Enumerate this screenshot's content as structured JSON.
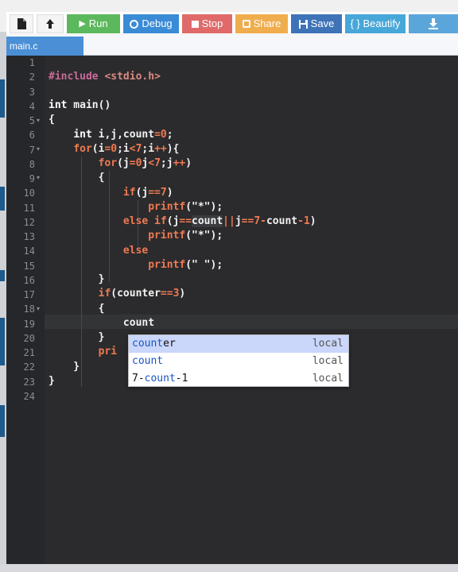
{
  "toolbar": {
    "buttons": [
      {
        "id": "new-file",
        "label": "",
        "icon": "file-icon",
        "color": "#f4f4f4"
      },
      {
        "id": "upload",
        "label": "",
        "icon": "upload-icon",
        "color": "#f4f4f4"
      },
      {
        "id": "run",
        "label": "Run",
        "icon": "play-icon",
        "color": "#5cb85c"
      },
      {
        "id": "debug",
        "label": "Debug",
        "icon": "debug-icon",
        "color": "#3a8bd6"
      },
      {
        "id": "stop",
        "label": "Stop",
        "icon": "stop-icon",
        "color": "#e06a6a"
      },
      {
        "id": "share",
        "label": "Share",
        "icon": "share-icon",
        "color": "#f0ad4e"
      },
      {
        "id": "save",
        "label": "Save",
        "icon": "floppy-icon",
        "color": "#3f73b8"
      },
      {
        "id": "beautify",
        "label": "{ } Beautify",
        "icon": "",
        "color": "#47a7d9"
      },
      {
        "id": "download",
        "label": "",
        "icon": "download-icon",
        "color": "#5aa6da"
      }
    ]
  },
  "tab": {
    "label": "main.c"
  },
  "editor": {
    "line_numbers": [
      "1",
      "2",
      "3",
      "4",
      "5",
      "6",
      "7",
      "8",
      "9",
      "10",
      "11",
      "12",
      "13",
      "14",
      "15",
      "16",
      "17",
      "18",
      "19",
      "20",
      "21",
      "22",
      "23",
      "24"
    ],
    "current_input": "count"
  },
  "autocomplete": {
    "items": [
      {
        "match": "count",
        "rest": "er",
        "meta": "local"
      },
      {
        "match": "count",
        "rest": "",
        "meta": "local"
      },
      {
        "pre": "7-",
        "match": "count",
        "rest": "-1",
        "meta": "local"
      }
    ]
  },
  "colors": {
    "editor_bg": "#2b2b2d",
    "keyword": "#ffffff",
    "number_operator": "#f07a52",
    "tab_active": "#4b8fd6"
  }
}
